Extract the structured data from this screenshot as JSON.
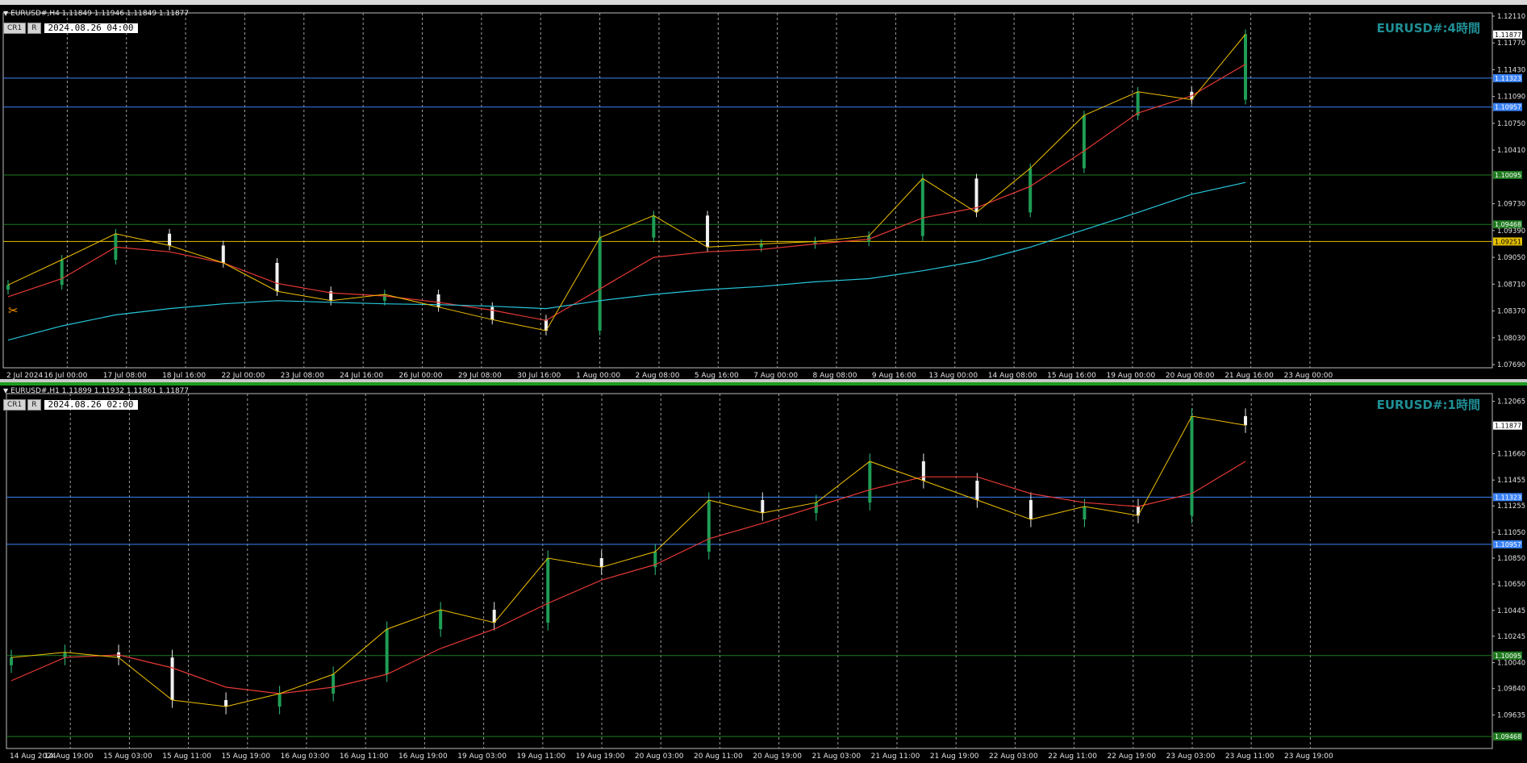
{
  "panels": [
    {
      "symbol_info": "EURUSD#,H4  1.11849 1.11946 1.11849 1.11877",
      "buttons": [
        "CR1",
        "R"
      ],
      "datetime": "2024.08.26 04:00",
      "chart_title": "EURUSD#:4時間",
      "price_labels": [
        "1.12110",
        "1.11770",
        "1.11430",
        "1.11090",
        "1.10750",
        "1.10410",
        "1.09730",
        "1.09390",
        "1.09050",
        "1.08710",
        "1.08370",
        "1.08030",
        "1.07690"
      ],
      "current_price": "1.11877",
      "hlines": [
        {
          "label": "1.11323",
          "color": "#3b82f6"
        },
        {
          "label": "1.10957",
          "color": "#3b82f6"
        },
        {
          "label": "1.10095",
          "color": "#1f7a1f"
        },
        {
          "label": "1.09468",
          "color": "#1f7a1f"
        },
        {
          "label": "1.09251",
          "color": "#e5c100"
        }
      ],
      "time_labels": [
        "2 Jul 2024",
        "16 Jul 00:00",
        "17 Jul 08:00",
        "18 Jul 16:00",
        "22 Jul 00:00",
        "23 Jul 08:00",
        "24 Jul 16:00",
        "26 Jul 00:00",
        "29 Jul 08:00",
        "30 Jul 16:00",
        "1 Aug 00:00",
        "2 Aug 08:00",
        "5 Aug 16:00",
        "7 Aug 00:00",
        "8 Aug 08:00",
        "9 Aug 16:00",
        "13 Aug 00:00",
        "14 Aug 08:00",
        "15 Aug 16:00",
        "19 Aug 00:00",
        "20 Aug 08:00",
        "21 Aug 16:00",
        "23 Aug 00:00"
      ]
    },
    {
      "symbol_info": "EURUSD#,H1  1.11899 1.11932 1.11861 1.11877",
      "buttons": [
        "CR1",
        "R"
      ],
      "datetime": "2024.08.26 02:00",
      "chart_title": "EURUSD#:1時間",
      "price_labels": [
        "1.12065",
        "1.11660",
        "1.11455",
        "1.11255",
        "1.11050",
        "1.10850",
        "1.10650",
        "1.10445",
        "1.10245",
        "1.10040",
        "1.09840",
        "1.09635"
      ],
      "current_price": "1.11877",
      "hlines": [
        {
          "label": "1.11323",
          "color": "#3b82f6"
        },
        {
          "label": "1.10957",
          "color": "#3b82f6"
        },
        {
          "label": "1.10095",
          "color": "#1f7a1f"
        },
        {
          "label": "1.09468",
          "color": "#1f7a1f"
        }
      ],
      "time_labels": [
        "14 Aug 2024",
        "14 Aug 19:00",
        "15 Aug 03:00",
        "15 Aug 11:00",
        "15 Aug 19:00",
        "16 Aug 03:00",
        "16 Aug 11:00",
        "16 Aug 19:00",
        "19 Aug 03:00",
        "19 Aug 11:00",
        "19 Aug 19:00",
        "20 Aug 03:00",
        "20 Aug 11:00",
        "20 Aug 19:00",
        "21 Aug 03:00",
        "21 Aug 11:00",
        "21 Aug 19:00",
        "22 Aug 03:00",
        "22 Aug 11:00",
        "22 Aug 19:00",
        "23 Aug 03:00",
        "23 Aug 11:00",
        "23 Aug 19:00"
      ]
    }
  ],
  "chart_data": [
    {
      "type": "candlestick",
      "symbol": "EURUSD#",
      "timeframe": "H4",
      "ylim": [
        1.0769,
        1.1211
      ],
      "x": [
        "2 Jul",
        "16 Jul",
        "17 Jul",
        "18 Jul",
        "22 Jul",
        "23 Jul",
        "24 Jul",
        "26 Jul",
        "29 Jul",
        "30 Jul",
        "1 Aug",
        "2 Aug",
        "5 Aug",
        "7 Aug",
        "8 Aug",
        "9 Aug",
        "13 Aug",
        "14 Aug",
        "15 Aug",
        "19 Aug",
        "20 Aug",
        "21 Aug",
        "23 Aug",
        "26 Aug"
      ],
      "close": [
        1.087,
        1.0902,
        1.0935,
        1.092,
        1.0898,
        1.0862,
        1.085,
        1.0858,
        1.0842,
        1.0826,
        1.0812,
        1.093,
        1.0958,
        1.0918,
        1.0922,
        1.0925,
        1.0932,
        1.1005,
        1.0962,
        1.1018,
        1.1085,
        1.1115,
        1.1105,
        1.1188
      ],
      "series": [
        {
          "name": "MA fast",
          "color": "#e53935",
          "values": [
            1.0855,
            1.0878,
            1.0918,
            1.0912,
            1.0898,
            1.0872,
            1.086,
            1.0856,
            1.0848,
            1.0838,
            1.0825,
            1.0865,
            1.0905,
            1.0912,
            1.0915,
            1.0922,
            1.0928,
            1.0955,
            1.0968,
            1.0995,
            1.104,
            1.1088,
            1.111,
            1.115
          ]
        },
        {
          "name": "MA slow",
          "color": "#26c6da",
          "values": [
            1.08,
            1.0818,
            1.0832,
            1.084,
            1.0846,
            1.085,
            1.0848,
            1.0846,
            1.0845,
            1.0843,
            1.084,
            1.085,
            1.0858,
            1.0864,
            1.0868,
            1.0874,
            1.0878,
            1.0888,
            1.09,
            1.0918,
            1.094,
            1.0962,
            1.0985,
            1.1
          ]
        }
      ]
    },
    {
      "type": "candlestick",
      "symbol": "EURUSD#",
      "timeframe": "H1",
      "ylim": [
        1.094,
        1.121
      ],
      "x": [
        "14 Aug",
        "14 Aug 19:00",
        "15 Aug 03:00",
        "15 Aug 11:00",
        "15 Aug 19:00",
        "16 Aug 03:00",
        "16 Aug 11:00",
        "16 Aug 19:00",
        "19 Aug 03:00",
        "19 Aug 11:00",
        "19 Aug 19:00",
        "20 Aug 03:00",
        "20 Aug 11:00",
        "20 Aug 19:00",
        "21 Aug 03:00",
        "21 Aug 11:00",
        "21 Aug 19:00",
        "22 Aug 03:00",
        "22 Aug 11:00",
        "22 Aug 19:00",
        "23 Aug 03:00",
        "23 Aug 11:00",
        "23 Aug 19:00",
        "26 Aug"
      ],
      "close": [
        1.1008,
        1.1012,
        1.1008,
        1.0975,
        1.097,
        1.098,
        1.0995,
        1.103,
        1.1045,
        1.1035,
        1.1085,
        1.1078,
        1.109,
        1.113,
        1.112,
        1.1128,
        1.116,
        1.1145,
        1.113,
        1.1115,
        1.1125,
        1.1118,
        1.1195,
        1.1188
      ],
      "series": [
        {
          "name": "MA",
          "color": "#e53935",
          "values": [
            1.099,
            1.1008,
            1.101,
            1.1,
            1.0985,
            1.098,
            1.0985,
            1.0995,
            1.1015,
            1.103,
            1.105,
            1.1068,
            1.108,
            1.11,
            1.1112,
            1.1125,
            1.1138,
            1.1148,
            1.1148,
            1.1135,
            1.1128,
            1.1125,
            1.1135,
            1.116
          ]
        }
      ]
    }
  ]
}
